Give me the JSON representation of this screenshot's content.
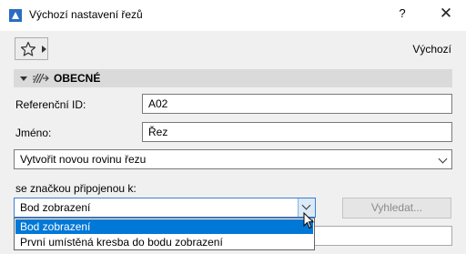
{
  "window": {
    "title": "Výchozí nastavení řezů",
    "help_label": "?",
    "close_label": "✕"
  },
  "toolbar": {
    "favorites_icon": "star-icon",
    "default_label": "Výchozí"
  },
  "section": {
    "title": "OBECNÉ",
    "icon": "section-icon"
  },
  "fields": {
    "ref_id_label": "Referenční ID:",
    "ref_id_value": "A02",
    "name_label": "Jméno:",
    "name_value": "Řez",
    "plane_select_value": "Vytvořit novou rovinu řezu",
    "marker_label": "se značkou připojenou k:",
    "marker_value": "Bod zobrazení",
    "search_button": "Vyhledat..."
  },
  "dropdown": {
    "options": [
      "Bod zobrazení",
      "První umístěná kresba do bodu zobrazení"
    ],
    "selected_index": 0
  },
  "colors": {
    "selection": "#0078d7",
    "panel_header": "#dadada",
    "background": "#f0f0f0"
  }
}
